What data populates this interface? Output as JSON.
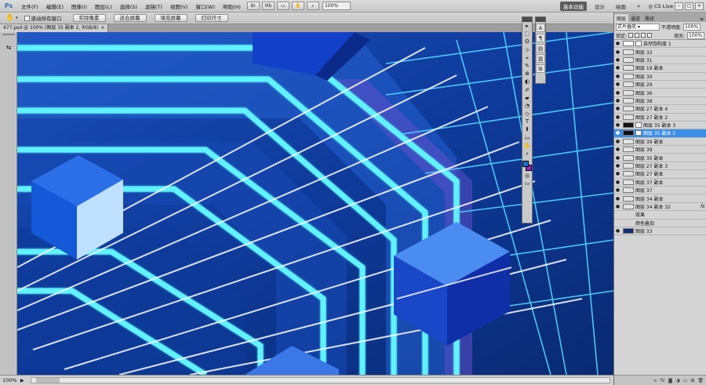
{
  "app": {
    "logo": "Ps"
  },
  "menu": [
    "文件(F)",
    "编辑(E)",
    "图像(I)",
    "图层(L)",
    "选择(S)",
    "滤镜(T)",
    "视图(V)",
    "窗口(W)",
    "帮助(H)"
  ],
  "menubar": {
    "mini_buttons": [
      "Br",
      "Mb",
      "▭",
      "✋",
      "⌕"
    ],
    "zoom": "100%",
    "workspaces": [
      "基本功能",
      "设计",
      "绘画"
    ],
    "more": "»",
    "cs_live": "CS Live",
    "window_controls": [
      "–",
      "▢",
      "×"
    ]
  },
  "options": {
    "scroll_all_label": "滚动所有窗口",
    "buttons": [
      "实际像素",
      "适合屏幕",
      "填充屏幕",
      "打印尺寸"
    ]
  },
  "document": {
    "tab": "477.psd @ 100% (图层 35 副本 2, RGB/8)",
    "close": "×",
    "zoom_status": "100%",
    "status_arrow": "▶"
  },
  "colors": {
    "canvas_dark": "#0a2f7a",
    "canvas_mid": "#1a55c6",
    "neon": "#5ff2ff",
    "cube_light": "#bfe0ff",
    "selection": "#3b8fe8",
    "foreground": "#1a6fd6",
    "background": "#a020c8"
  },
  "tools": [
    "▸",
    "⬚",
    "ʘ",
    "⊹",
    "⌖",
    "✎",
    "⊕",
    "◐",
    "✐",
    "▰",
    "◔",
    "◇",
    "T",
    "⬆",
    "▭",
    "✋",
    "⌕"
  ],
  "side_dock_icons": [
    "A",
    "¶",
    "▤",
    "▥",
    "⊞"
  ],
  "layers_panel": {
    "tabs": [
      "图层",
      "通道",
      "路径"
    ],
    "menu": "≡",
    "blend_mode": "正片叠底",
    "opacity_label": "不透明度:",
    "opacity": "100%",
    "lock_label": "锁定:",
    "fill_label": "填充:",
    "fill": "100%",
    "layers": [
      {
        "name": "自然饱和度 1",
        "thumb": "white",
        "mask": true,
        "selected": false,
        "fx": "",
        "sub": false
      },
      {
        "name": "图层 32",
        "thumb": "checker",
        "mask": false,
        "selected": false,
        "fx": "",
        "sub": false
      },
      {
        "name": "图层 31",
        "thumb": "checker",
        "mask": false,
        "selected": false,
        "fx": "",
        "sub": false
      },
      {
        "name": "图层 19 副本",
        "thumb": "checker",
        "mask": false,
        "selected": false,
        "fx": "",
        "sub": false
      },
      {
        "name": "图层 30",
        "thumb": "checker",
        "mask": false,
        "selected": false,
        "fx": "",
        "sub": false
      },
      {
        "name": "图层 29",
        "thumb": "checker",
        "mask": false,
        "selected": false,
        "fx": "",
        "sub": false
      },
      {
        "name": "图层 36",
        "thumb": "checker",
        "mask": false,
        "selected": false,
        "fx": "",
        "sub": false
      },
      {
        "name": "图层 38",
        "thumb": "checker",
        "mask": false,
        "selected": false,
        "fx": "",
        "sub": false
      },
      {
        "name": "图层 27 副本 4",
        "thumb": "checker",
        "mask": false,
        "selected": false,
        "fx": "",
        "sub": false
      },
      {
        "name": "图层 27 副本 2",
        "thumb": "checker",
        "mask": false,
        "selected": false,
        "fx": "",
        "sub": false
      },
      {
        "name": "图层 35 副本 3",
        "thumb": "mask",
        "mask": true,
        "selected": false,
        "fx": "",
        "sub": false
      },
      {
        "name": "图层 35 副本 2",
        "thumb": "mask",
        "mask": true,
        "selected": true,
        "fx": "",
        "sub": false
      },
      {
        "name": "图层 39 副本",
        "thumb": "checker",
        "mask": false,
        "selected": false,
        "fx": "",
        "sub": false
      },
      {
        "name": "图层 39",
        "thumb": "checker",
        "mask": false,
        "selected": false,
        "fx": "",
        "sub": false
      },
      {
        "name": "图层 35 副本",
        "thumb": "checker",
        "mask": false,
        "selected": false,
        "fx": "",
        "sub": false
      },
      {
        "name": "图层 27 副本 3",
        "thumb": "checker",
        "mask": false,
        "selected": false,
        "fx": "",
        "sub": false
      },
      {
        "name": "图层 27 副本",
        "thumb": "checker",
        "mask": false,
        "selected": false,
        "fx": "",
        "sub": false
      },
      {
        "name": "图层 37 副本",
        "thumb": "checker",
        "mask": false,
        "selected": false,
        "fx": "",
        "sub": false
      },
      {
        "name": "图层 37",
        "thumb": "checker",
        "mask": false,
        "selected": false,
        "fx": "",
        "sub": false
      },
      {
        "name": "图层 34 副本",
        "thumb": "checker",
        "mask": false,
        "selected": false,
        "fx": "",
        "sub": false
      },
      {
        "name": "图层 34 副本 32",
        "thumb": "checker",
        "mask": false,
        "selected": false,
        "fx": "fx",
        "sub": false
      },
      {
        "name": "效果",
        "thumb": "",
        "mask": false,
        "selected": false,
        "fx": "",
        "sub": true
      },
      {
        "name": "颜色叠加",
        "thumb": "",
        "mask": false,
        "selected": false,
        "fx": "",
        "sub": true
      },
      {
        "name": "图层 33",
        "thumb": "dark",
        "mask": false,
        "selected": false,
        "fx": "",
        "sub": false
      }
    ],
    "bottom_icons": [
      "∞",
      "fx",
      "◙",
      "◑",
      "▭",
      "⊞",
      "🗑"
    ]
  }
}
